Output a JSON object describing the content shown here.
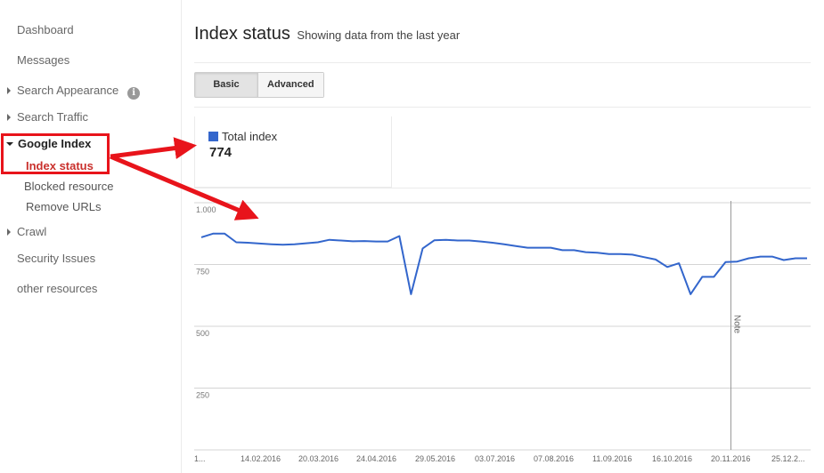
{
  "sidebar": {
    "dashboard": "Dashboard",
    "messages": "Messages",
    "search_appearance": "Search Appearance",
    "search_traffic": "Search Traffic",
    "google_index": "Google Index",
    "index_status": "Index status",
    "blocked_resource": "Blocked resource",
    "remove_urls": "Remove URLs",
    "crawl": "Crawl",
    "security_issues": "Security Issues",
    "other_resources": "other resources",
    "info_icon": "i"
  },
  "header": {
    "title": "Index status",
    "subtitle": "Showing data from the last year"
  },
  "tabs": {
    "basic": "Basic",
    "advanced": "Advanced"
  },
  "metric": {
    "label": "Total index",
    "value": "774",
    "color": "#3366cc"
  },
  "annotation_color": "#e8141b",
  "chart_data": {
    "type": "line",
    "series": [
      {
        "name": "Total index",
        "color": "#3366cc",
        "values": [
          860,
          875,
          875,
          840,
          838,
          835,
          832,
          830,
          832,
          836,
          840,
          850,
          847,
          844,
          845,
          843,
          843,
          865,
          630,
          815,
          848,
          850,
          847,
          847,
          843,
          838,
          832,
          825,
          818,
          818,
          818,
          808,
          808,
          800,
          798,
          792,
          792,
          790,
          780,
          770,
          740,
          755,
          630,
          700,
          700,
          760,
          762,
          775,
          782,
          782,
          768,
          775,
          775
        ]
      }
    ],
    "x_tick_labels": [
      "1...",
      "14.02.2016",
      "20.03.2016",
      "24.04.2016",
      "29.05.2016",
      "03.07.2016",
      "07.08.2016",
      "11.09.2016",
      "16.10.2016",
      "20.11.2016",
      "25.12.2..."
    ],
    "y_tick_labels": [
      "1.000",
      "750",
      "500",
      "250"
    ],
    "y_ticks": [
      1000,
      750,
      500,
      250
    ],
    "ylim": [
      0,
      1000
    ],
    "grid": true,
    "note_label": "Note",
    "note_index": 46
  }
}
